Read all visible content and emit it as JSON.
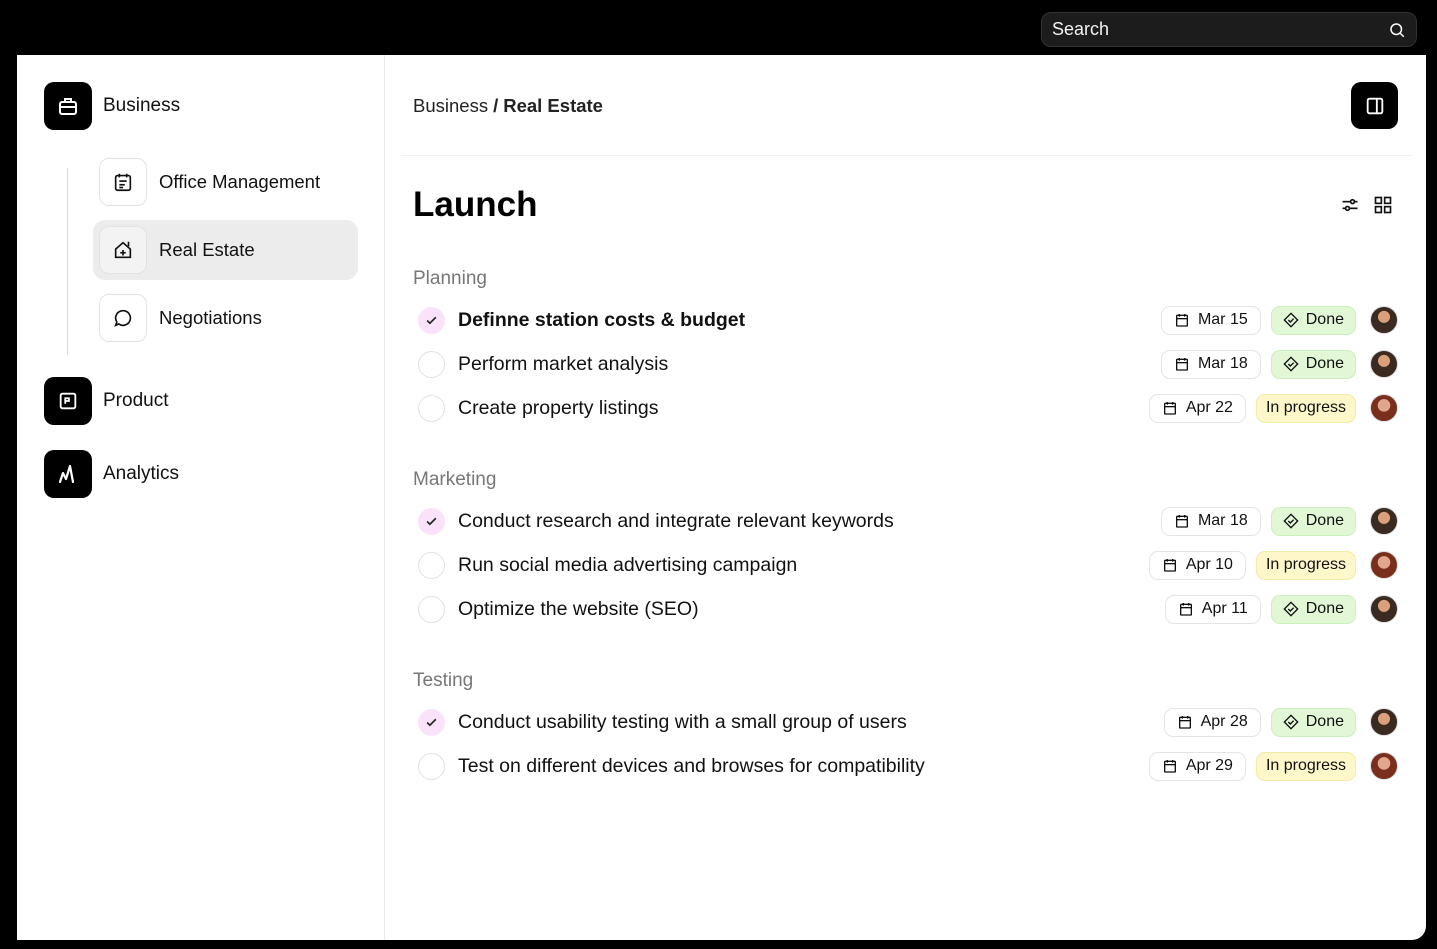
{
  "search": {
    "placeholder": "Search"
  },
  "sidebar": {
    "groups": [
      {
        "label": "Business",
        "icon": "briefcase-icon"
      },
      {
        "label": "Product",
        "icon": "product-icon"
      },
      {
        "label": "Analytics",
        "icon": "analytics-icon"
      }
    ],
    "business_items": [
      {
        "label": "Office Management",
        "icon": "calendar-list-icon",
        "active": false
      },
      {
        "label": "Real Estate",
        "icon": "house-icon",
        "active": true
      },
      {
        "label": "Negotiations",
        "icon": "chat-bubble-icon",
        "active": false
      }
    ]
  },
  "header": {
    "breadcrumb": {
      "parent": "Business",
      "separator": "/",
      "current": "Real Estate"
    },
    "title": "Launch"
  },
  "sections": [
    {
      "title": "Planning",
      "tasks": [
        {
          "label": "Definne station costs & budget",
          "done": true,
          "date": "Mar 15",
          "status": "Done"
        },
        {
          "label": "Perform market analysis",
          "done": false,
          "date": "Mar 18",
          "status": "Done"
        },
        {
          "label": "Create property listings",
          "done": false,
          "date": "Apr 22",
          "status": "In progress"
        }
      ]
    },
    {
      "title": "Marketing",
      "tasks": [
        {
          "label": "Conduct research and integrate relevant keywords",
          "done": true,
          "date": "Mar 18",
          "status": "Done"
        },
        {
          "label": "Run social media advertising campaign",
          "done": false,
          "date": "Apr 10",
          "status": "In progress"
        },
        {
          "label": "Optimize the website (SEO)",
          "done": false,
          "date": "Apr 11",
          "status": "Done"
        }
      ]
    },
    {
      "title": "Testing",
      "tasks": [
        {
          "label": "Conduct usability testing with a small group of users",
          "done": true,
          "date": "Apr 28",
          "status": "Done"
        },
        {
          "label": "Test on different devices and browses for compatibility",
          "done": false,
          "date": "Apr 29",
          "status": "In progress"
        }
      ]
    }
  ],
  "colors": {
    "done_bg": "#e1f7d6",
    "progress_bg": "#fdf7c9",
    "check_bg": "#fae3fa",
    "active_nav_bg": "#ececec"
  }
}
